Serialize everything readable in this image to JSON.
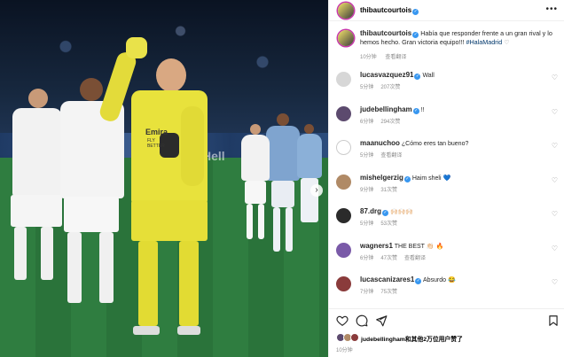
{
  "photo": {
    "sponsor_text": "Emira",
    "sponsor_sub": "FLY BETTER",
    "ad_board": "Hell"
  },
  "header": {
    "username": "thibautcourtois",
    "more": "•••"
  },
  "caption": {
    "username": "thibautcourtois",
    "text": "Había que responder frente a un gran rival y lo hemos hecho. Gran victoria equipo!!! ",
    "hashtag": "#HalaMadrid",
    "heart": "♡",
    "time": "10分钟",
    "translate": "查看翻译"
  },
  "comments": [
    {
      "username": "lucasvazquez91",
      "verified": true,
      "text": "Wall",
      "time": "5分钟",
      "likes": "207次赞",
      "translate": "",
      "color": "#d7d7d7"
    },
    {
      "username": "judebellingham",
      "verified": true,
      "text": "!!",
      "time": "6分钟",
      "likes": "294次赞",
      "translate": "",
      "color": "#5c4a6e"
    },
    {
      "username": "maanuchoo",
      "verified": false,
      "text": "¿Cómo eres tan bueno?",
      "time": "5分钟",
      "likes": "",
      "translate": "查看翻译",
      "color": "#ffffff"
    },
    {
      "username": "mishelgerzig",
      "verified": true,
      "text": "Haim sheli 💙",
      "time": "9分钟",
      "likes": "31次赞",
      "translate": "",
      "color": "#b08a66"
    },
    {
      "username": "87.drg",
      "verified": true,
      "text": "🙌🏻🙌🏻🙌🏻",
      "time": "5分钟",
      "likes": "53次赞",
      "translate": "",
      "color": "#2b2b2b"
    },
    {
      "username": "wagners1",
      "verified": false,
      "text": "THE BEST 👏🏻 🔥",
      "time": "6分钟",
      "likes": "47次赞",
      "translate": "查看翻译",
      "color": "#7a5aa8"
    },
    {
      "username": "lucascanizares1",
      "verified": true,
      "text": "Absurdo 😂",
      "time": "7分钟",
      "likes": "75次赞",
      "translate": "",
      "color": "#8a3b3b"
    }
  ],
  "reply_label": "",
  "liked_by": {
    "user": "judebellingham",
    "rest": "和其他2万位用户赞了"
  },
  "bottom_time": "10分钟",
  "colors": {
    "verified": "#3897f0",
    "hashtag": "#00376b",
    "gk_kit": "#e8e23c",
    "away_kit": "#f2f2f2"
  }
}
